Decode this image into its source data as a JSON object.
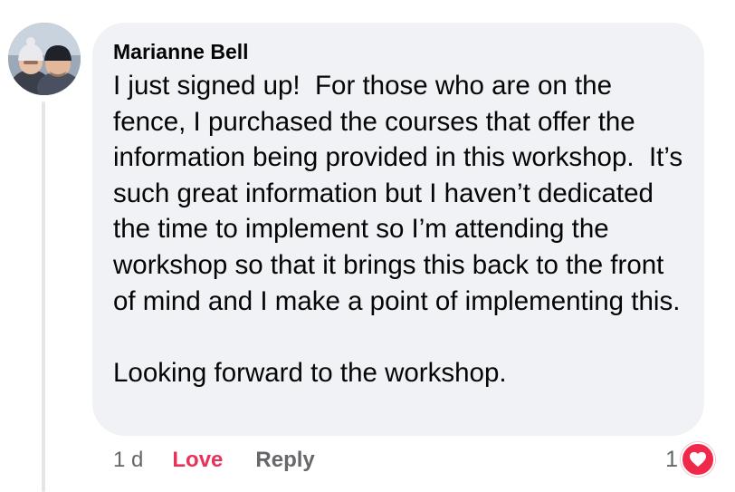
{
  "comment": {
    "author": "Marianne Bell",
    "text": "I just signed up!  For those who are on the fence, I purchased the courses that offer the information being provided in this workshop.  It’s such great information but I haven’t dedicated the time to implement so I’m attending the workshop so that it brings this back to the front of mind and I make a point of implementing this.\n\nLooking forward to the workshop.",
    "timestamp": "1 d",
    "love_label": "Love",
    "reply_label": "Reply",
    "reaction_count": "1",
    "reaction_icon": "heart-icon"
  },
  "colors": {
    "bubble": "#f0f2f5",
    "love_active": "#e8325a",
    "reaction_badge": "#f0284a",
    "muted_text": "#65676b"
  }
}
